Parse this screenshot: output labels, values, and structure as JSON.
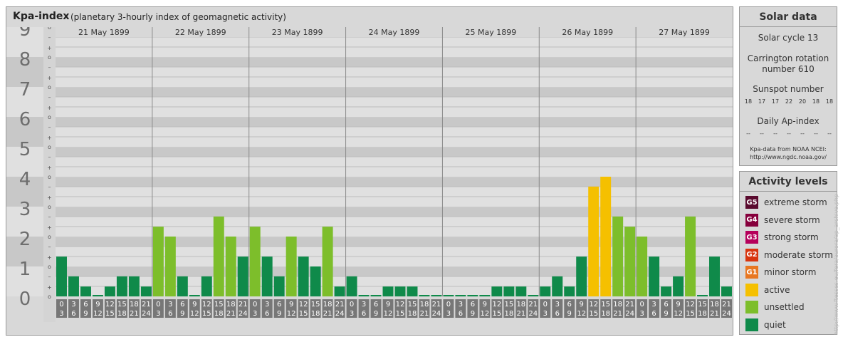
{
  "header": {
    "title": "Kpa-index",
    "subtitle": "(planetary 3-hourly index of geomagnetic activity)"
  },
  "chart_data": {
    "type": "bar",
    "title": "Kpa-index",
    "subtitle": "(planetary 3-hourly index of geomagnetic activity)",
    "ylim": [
      0,
      9
    ],
    "y_ticks": [
      "0",
      "1",
      "2",
      "3",
      "4",
      "5",
      "6",
      "7",
      "8",
      "9"
    ],
    "y_subticks": [
      "–",
      "o",
      "+"
    ],
    "interval_labels": [
      [
        "0",
        "3"
      ],
      [
        "3",
        "6"
      ],
      [
        "6",
        "9"
      ],
      [
        "9",
        "12"
      ],
      [
        "12",
        "15"
      ],
      [
        "15",
        "18"
      ],
      [
        "18",
        "21"
      ],
      [
        "21",
        "24"
      ]
    ],
    "days": [
      {
        "date": "21 May 1899",
        "values": [
          1.33,
          0.67,
          0.33,
          0,
          0.33,
          0.67,
          0.67,
          0.33
        ]
      },
      {
        "date": "22 May 1899",
        "values": [
          2.33,
          2.0,
          0.67,
          0,
          0.67,
          2.67,
          2.0,
          1.33
        ]
      },
      {
        "date": "23 May 1899",
        "values": [
          2.33,
          1.33,
          0.67,
          2.0,
          1.33,
          1.0,
          2.33,
          0.33
        ]
      },
      {
        "date": "24 May 1899",
        "values": [
          0.67,
          0,
          0,
          0.33,
          0.33,
          0.33,
          0,
          0
        ]
      },
      {
        "date": "25 May 1899",
        "values": [
          0,
          0,
          0,
          0,
          0.33,
          0.33,
          0.33,
          0
        ]
      },
      {
        "date": "26 May 1899",
        "values": [
          0.33,
          0.67,
          0.33,
          1.33,
          3.67,
          4.0,
          2.67,
          2.33
        ]
      },
      {
        "date": "27 May 1899",
        "values": [
          2.0,
          1.33,
          0.33,
          0.67,
          2.67,
          0,
          1.33,
          0.33
        ]
      }
    ],
    "grid": true
  },
  "solar_data": {
    "title": "Solar data",
    "solar_cycle": "Solar cycle 13",
    "carrington_line1": "Carrington rotation",
    "carrington_line2": "number 610",
    "sunspot_label": "Sunspot number",
    "sunspot_values": [
      "18",
      "17",
      "17",
      "22",
      "20",
      "18",
      "18"
    ],
    "ap_label": "Daily Ap-index",
    "ap_values": [
      "--",
      "--",
      "--",
      "--",
      "--",
      "--",
      "--"
    ],
    "credit_line1": "Kpa-data from NOAA NCEI:",
    "credit_line2": "http://www.ngdc.noaa.gov/"
  },
  "activity_levels": {
    "title": "Activity levels",
    "items": [
      {
        "badge": "G5",
        "label": "extreme storm",
        "color": "#5a0a2e"
      },
      {
        "badge": "G4",
        "label": "severe storm",
        "color": "#86003c"
      },
      {
        "badge": "G3",
        "label": "strong storm",
        "color": "#b5005b"
      },
      {
        "badge": "G2",
        "label": "moderate storm",
        "color": "#d8350f"
      },
      {
        "badge": "G1",
        "label": "minor storm",
        "color": "#e87722"
      },
      {
        "badge": "",
        "label": "active",
        "color": "#f5c000"
      },
      {
        "badge": "",
        "label": "unsettled",
        "color": "#7dbe2b"
      },
      {
        "badge": "",
        "label": "quiet",
        "color": "#0f8a4a"
      }
    ]
  },
  "watermark": "http://www.ftesses.eu/fera/aurora/ap_archive.php"
}
